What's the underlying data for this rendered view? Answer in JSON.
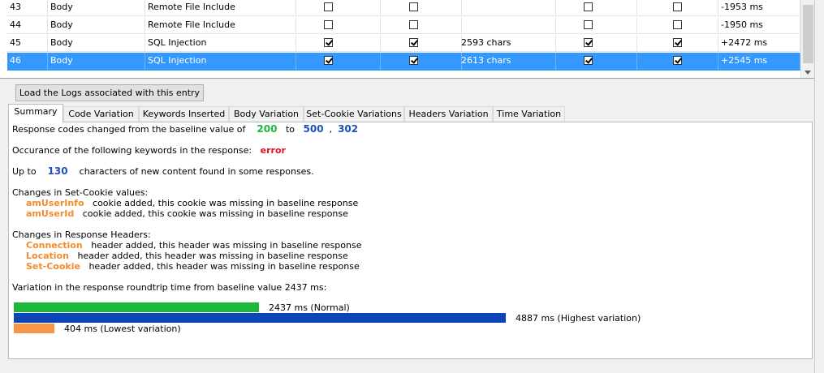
{
  "grid": {
    "rows": [
      {
        "id": "43",
        "location": "Body",
        "check": "Remote File Include",
        "c1": false,
        "c2": false,
        "chars": "",
        "c3": false,
        "c4": false,
        "time": "-1953 ms",
        "selected": false
      },
      {
        "id": "44",
        "location": "Body",
        "check": "Remote File Include",
        "c1": false,
        "c2": false,
        "chars": "",
        "c3": false,
        "c4": false,
        "time": "-1950 ms",
        "selected": false
      },
      {
        "id": "45",
        "location": "Body",
        "check": "SQL Injection",
        "c1": true,
        "c2": true,
        "chars": "2593 chars",
        "c3": true,
        "c4": true,
        "time": "+2472 ms",
        "selected": false
      },
      {
        "id": "46",
        "location": "Body",
        "check": "SQL Injection",
        "c1": true,
        "c2": true,
        "chars": "2613 chars",
        "c3": true,
        "c4": true,
        "time": "+2545 ms",
        "selected": true
      }
    ]
  },
  "load_button": "Load the Logs associated with this entry",
  "tabs": [
    "Summary",
    "Code Variation",
    "Keywords Inserted",
    "Body Variation",
    "Set-Cookie Variations",
    "Headers Variation",
    "Time Variation"
  ],
  "active_tab": "Summary",
  "summary": {
    "codes_prefix": "Response codes changed from the baseline value of",
    "baseline_code": "200",
    "to_word": "to",
    "new_code_1": "500",
    "comma": ",",
    "new_code_2": "302",
    "keywords_prefix": "Occurance of the following keywords in the response:",
    "keyword": "error",
    "upto_prefix": "Up to",
    "chars_count": "130",
    "chars_suffix": "characters of new content found in some responses.",
    "cookie_heading": "Changes in Set-Cookie values:",
    "cookies": [
      {
        "name": "amUserInfo",
        "text": "cookie added, this cookie was missing in baseline response"
      },
      {
        "name": "amUserId",
        "text": "cookie added, this cookie was missing in baseline response"
      }
    ],
    "headers_heading": "Changes in Response Headers:",
    "headers": [
      {
        "name": "Connection",
        "text": "header added, this header was missing in baseline response"
      },
      {
        "name": "Location",
        "text": "header added, this header was missing in baseline response"
      },
      {
        "name": "Set-Cookie",
        "text": "header added, this header was missing in baseline response"
      }
    ],
    "time_heading": "Variation in the response roundtrip time from baseline value 2437 ms:",
    "time_bars": [
      {
        "value": 2437,
        "label": "2437 ms (Normal)",
        "color": "#1cb839"
      },
      {
        "value": 4887,
        "label": "4887 ms (Highest variation)",
        "color": "#0c45b5"
      },
      {
        "value": 404,
        "label": "404 ms (Lowest variation)",
        "color": "#f79646"
      }
    ]
  },
  "colors": {
    "selection": "#3399ff",
    "green": "#1cb839",
    "blue": "#1f4fc1",
    "red": "#e0141e",
    "orange": "#f28c2c"
  }
}
